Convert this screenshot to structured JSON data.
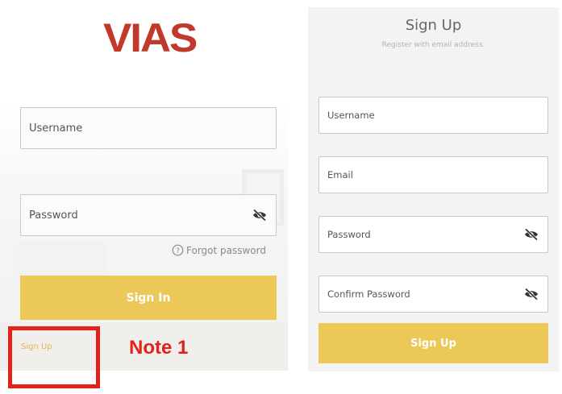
{
  "brand": {
    "logo_text": "VIAS",
    "logo_color": "#c0392b"
  },
  "sign_in": {
    "username_placeholder": "Username",
    "password_placeholder": "Password",
    "forgot_label": "Forgot password",
    "button_label": "Sign In",
    "signup_link": "Sign Up"
  },
  "annotation": {
    "label": "Note 1",
    "color": "#e2231a"
  },
  "sign_up": {
    "title": "Sign Up",
    "subtitle": "Register with email address.",
    "username_placeholder": "Username",
    "email_placeholder": "Email",
    "password_placeholder": "Password",
    "confirm_placeholder": "Confirm Password",
    "button_label": "Sign Up"
  },
  "icons": {
    "password_toggle": "eye-slash-icon",
    "forgot": "help-circle-icon"
  },
  "colors": {
    "accent": "#ebc858",
    "link": "#e3b54a"
  }
}
